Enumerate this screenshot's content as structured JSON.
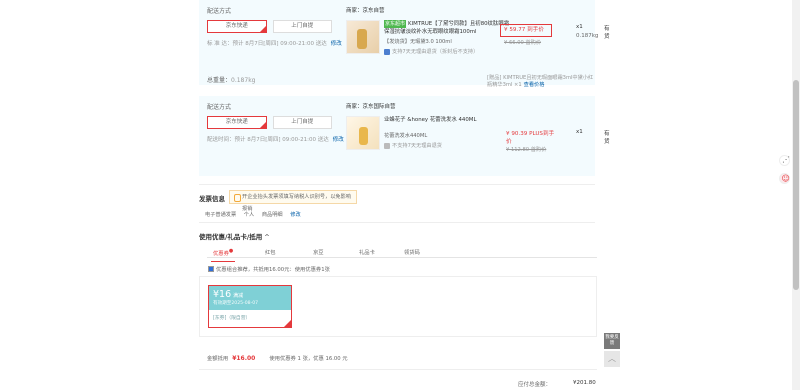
{
  "package1": {
    "ship_label": "配送方式",
    "btn_express": "京东快递",
    "btn_pickup": "上门自提",
    "time_text": "标 准 达：预计 8月7日[周四] 09:00-21:00 送达",
    "edit": "修改",
    "weight_label": "总重量：",
    "weight_value": "0.187kg",
    "seller": "商家：京东自营",
    "item": {
      "tag": "京东超市",
      "name": "KIMTRUE【了黛兮同款】且初80纹肽眼霜保湿抗皱淡纹补水无瑕眼纹眼霜100ml",
      "sub": "【发烧货】无瑕黛3.0 100ml",
      "service": "支持7天无理由退货（拆封后不支持）",
      "price": "¥ 59.77 到手价",
      "old_price": "¥ 66.00 首购价",
      "qty": "x1",
      "weight": "0.187kg",
      "stock": "有货"
    },
    "gift": "[赠品]  KIMTRUE且初无瑕面眼霜3ml中黛小红瓶精华3ml ×1",
    "gift_view": "查看价格"
  },
  "package2": {
    "ship_label": "配送方式",
    "btn_express": "京东快递",
    "btn_pickup": "上门自提",
    "time_text": "配送时间：预计 8月7日[周四] 09:00-21:00 送达",
    "edit": "修改",
    "seller": "商家：京东国际自营",
    "item": {
      "name": "业蜂花子 &honey 花蕾洗发水 440ML",
      "sub": "花蕾洗发水440ML",
      "service": "不支持7天无理由退货",
      "price": "¥ 90.39 PLUS到手价",
      "old_price": "¥ 112.80 首购价",
      "qty": "x1",
      "stock": "有货"
    }
  },
  "invoice": {
    "title": "发票信息",
    "tip": "开企业抬头发票须填写纳税人识别号，以免影响报销",
    "type": "电子普通发票",
    "person": "个人",
    "detail": "商品明细",
    "edit": "修改"
  },
  "coupons": {
    "header": "使用优惠/礼品卡/抵用",
    "chevron": "^",
    "tabs": [
      "优惠券",
      "红包",
      "京豆",
      "礼品卡",
      "领货码"
    ],
    "tab_mark": "●",
    "check_text": "优惠组合推荐，共抵用16.00元：使用优惠券1张",
    "coupon": {
      "amount": "¥16",
      "type": "满减",
      "expiry": "有效期至2025-08-07",
      "limit": "[东券]（限自营）"
    },
    "sum_label": "金额抵用",
    "sum_amount": "¥16.00",
    "sum_rest": "使用优惠券 1 张，优惠 16.00 元"
  },
  "total": {
    "label": "应付总金额：",
    "value": "¥201.80"
  },
  "floating": {
    "feedback": "我要反馈",
    "to_top": "︿"
  },
  "colors": {
    "accent": "#e4393c",
    "link": "#005ea7",
    "package_bg": "#f3fbfe",
    "coupon_bg": "#7fd0d6"
  }
}
